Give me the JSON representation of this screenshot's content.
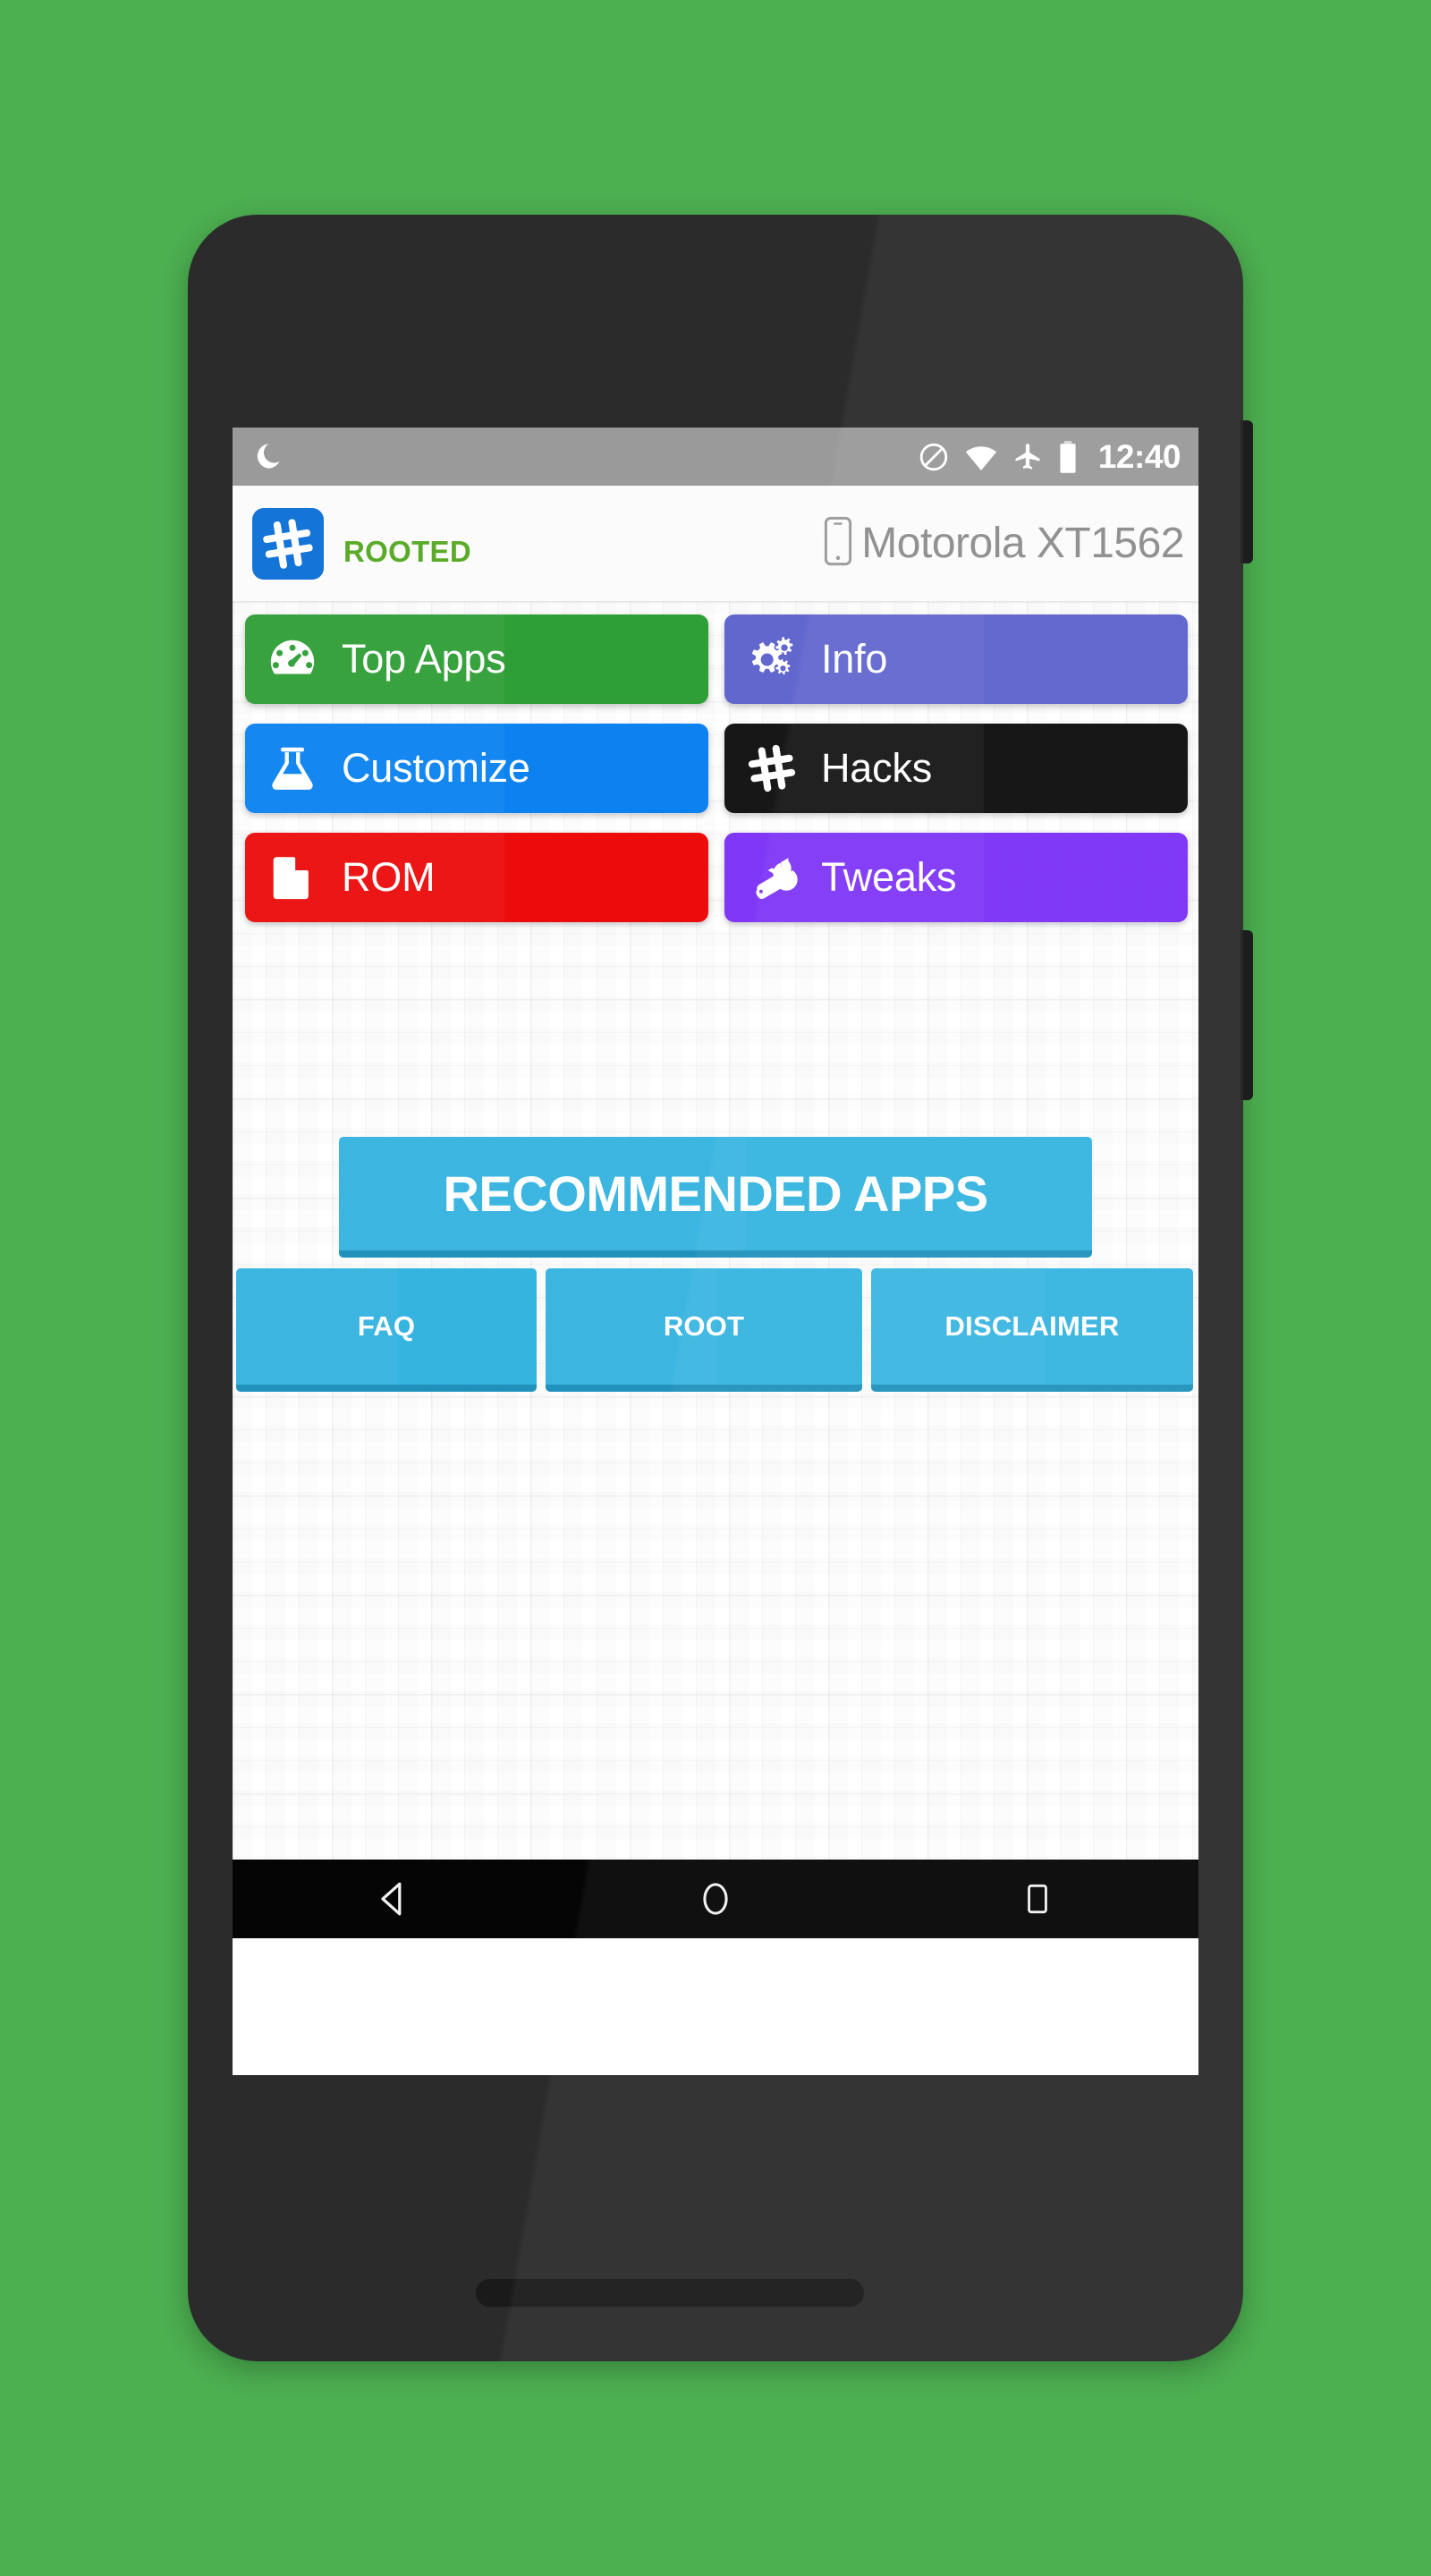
{
  "wallpaper": {
    "color": "#4caf50"
  },
  "device": {
    "frame_color": "#2b2b2b",
    "side_buttons": [
      {
        "name": "power-button"
      },
      {
        "name": "volume-button"
      }
    ]
  },
  "status_bar": {
    "background": "#9a9a9a",
    "time": "12:40",
    "icons": [
      "moon-icon",
      "do-not-disturb-icon",
      "wifi-icon",
      "airplane-mode-icon",
      "battery-icon"
    ]
  },
  "app_bar": {
    "logo_icon": "hashtag-logo-icon",
    "logo_background": "#1574d8",
    "root_status": "ROOTED",
    "root_status_color": "#5aab2a",
    "device_icon": "smartphone-icon",
    "device_name": "Motorola XT1562"
  },
  "main_buttons": [
    {
      "label": "Top Apps",
      "icon": "speedometer-icon",
      "color": "#2e9e36"
    },
    {
      "label": "Info",
      "icon": "gears-icon",
      "color": "#5b61cc"
    },
    {
      "label": "Customize",
      "icon": "flask-icon",
      "color": "#0b82f0"
    },
    {
      "label": "Hacks",
      "icon": "hashtag-icon",
      "color": "#0d0d0d"
    },
    {
      "label": "ROM",
      "icon": "document-icon",
      "color": "#ec0c0c"
    },
    {
      "label": "Tweaks",
      "icon": "wrench-icon",
      "color": "#7b2ff7"
    }
  ],
  "recommended": {
    "label": "RECOMMENDED APPS",
    "color": "#35b4e0",
    "shadow_color": "#2092bb"
  },
  "links": [
    {
      "label": "FAQ"
    },
    {
      "label": "ROOT"
    },
    {
      "label": "DISCLAIMER"
    }
  ],
  "nav_bar": {
    "background": "#050505",
    "keys": [
      {
        "name": "back-key",
        "icon": "triangle-back-icon"
      },
      {
        "name": "home-key",
        "icon": "circle-home-icon"
      },
      {
        "name": "recents-key",
        "icon": "square-recents-icon"
      }
    ]
  }
}
